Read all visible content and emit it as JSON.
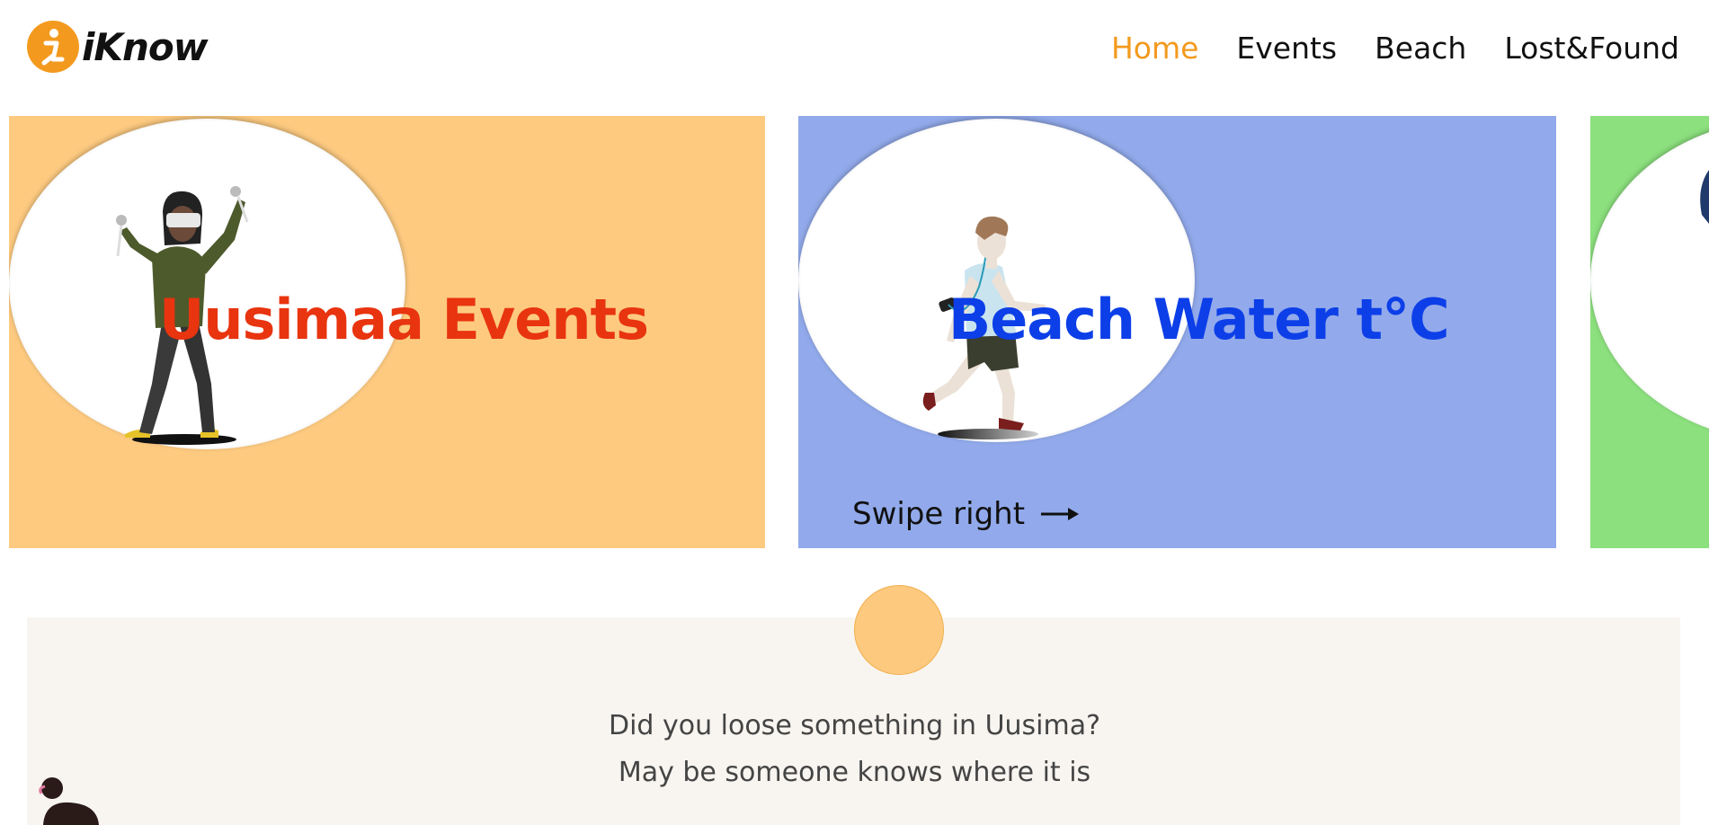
{
  "header": {
    "logo_text": "iKnow",
    "logo_icon": "info-person-icon",
    "nav": [
      {
        "label": "Home",
        "active": true
      },
      {
        "label": "Events",
        "active": false
      },
      {
        "label": "Beach",
        "active": false
      },
      {
        "label": "Lost&Found",
        "active": false
      }
    ]
  },
  "cards": [
    {
      "title": "Uusimaa Events",
      "background": "#fdca80",
      "title_color": "#e8340f",
      "figure": "vr-person-icon"
    },
    {
      "title": "Beach Water t°C",
      "background": "#92aaeb",
      "title_color": "#0d3fe8",
      "figure": "runner-icon",
      "swipe_label": "Swipe right",
      "swipe_icon": "arrow-right-icon"
    },
    {
      "background": "#8ce07e",
      "figure": "partial-person-icon"
    }
  ],
  "lost_found": {
    "line1": "Did you loose something in Uusima?",
    "line2": "May be someone knows where it is",
    "circle_color": "#fdc97f",
    "background": "#f8f5f0"
  },
  "colors": {
    "accent": "#f39a1e",
    "text": "#111111"
  }
}
